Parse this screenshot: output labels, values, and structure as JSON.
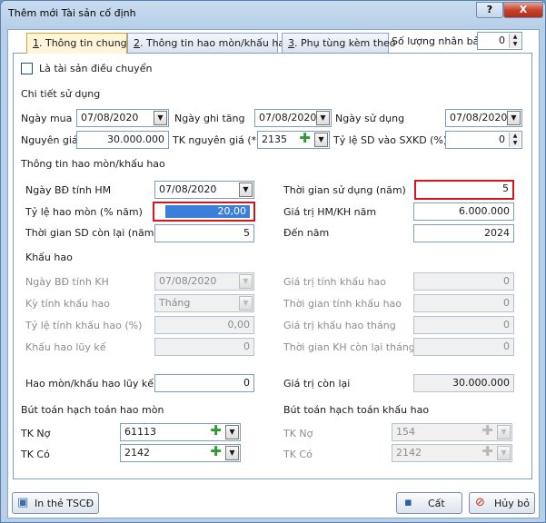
{
  "window": {
    "title": "Thêm mới Tài sản cố định",
    "help": "?",
    "close": "X"
  },
  "tabs": [
    {
      "key": "1",
      "label": ". Thông tin chung"
    },
    {
      "key": "2",
      "label": ". Thông tin hao mòn/khấu hao"
    },
    {
      "key": "3",
      "label": ". Phụ tùng kèm theo"
    }
  ],
  "copies": {
    "label": "Số lượng nhân bản",
    "value": "0"
  },
  "transfer": {
    "label": "Là tài sản điều chuyển"
  },
  "usage": {
    "section": "Chi tiết sử dụng",
    "buy_date_label": "Ngày mua",
    "buy_date": "07/08/2020",
    "record_date_label": "Ngày ghi tăng",
    "record_date": "07/08/2020",
    "use_date_label": "Ngày sử dụng",
    "use_date": "07/08/2020",
    "cost_label": "Nguyên giá",
    "cost": "30.000.000",
    "account_label": "TK nguyên giá (*)",
    "account": "2135",
    "sxkd_label": "Tỷ lệ SD vào SXKD (%)",
    "sxkd": "0"
  },
  "depreciation": {
    "section": "Thông tin hao mòn/khấu hao",
    "start_label": "Ngày BĐ tính HM",
    "start": "07/08/2020",
    "life_label": "Thời gian sử dụng (năm)",
    "life": "5",
    "rate_label": "Tỷ lệ hao mòn (% năm)",
    "rate": "20,00",
    "yearly_label": "Giá trị HM/KH năm",
    "yearly": "6.000.000",
    "remain_label": "Thời gian SD còn lại (năm)",
    "remain": "5",
    "until_label": "Đến năm",
    "until": "2024"
  },
  "amortization": {
    "section": "Khấu hao",
    "start_label": "Ngày BĐ tính KH",
    "start": "07/08/2020",
    "value_label": "Giá trị tính khấu hao",
    "value": "0",
    "period_label": "Kỳ tính khấu hao",
    "period": "Tháng",
    "time_label": "Thời gian tính khấu hao",
    "time": "0",
    "rate_label": "Tỷ lệ tính khấu hao (%)",
    "rate": "0,00",
    "monthly_label": "Giá trị khấu hao tháng",
    "monthly": "0",
    "accum_label": "Khấu hao lũy kế",
    "accum": "0",
    "remain_label": "Thời gian KH còn lại tháng",
    "remain": "0"
  },
  "totals": {
    "accum_label": "Hao mòn/khấu hao lũy kế",
    "accum": "0",
    "residual_label": "Giá trị còn lại",
    "residual": "30.000.000"
  },
  "entries_hm": {
    "section": "Bút toán hạch toán hao mòn",
    "debit_label": "TK Nợ",
    "debit": "61113",
    "credit_label": "TK Có",
    "credit": "2142"
  },
  "entries_kh": {
    "section": "Bút toán hạch toán khấu hao",
    "debit_label": "TK Nợ",
    "debit": "154",
    "credit_label": "TK Có",
    "credit": "2142"
  },
  "buttons": {
    "print": "In thẻ TSCĐ",
    "save": "Cất",
    "cancel": "Hủy bỏ"
  }
}
